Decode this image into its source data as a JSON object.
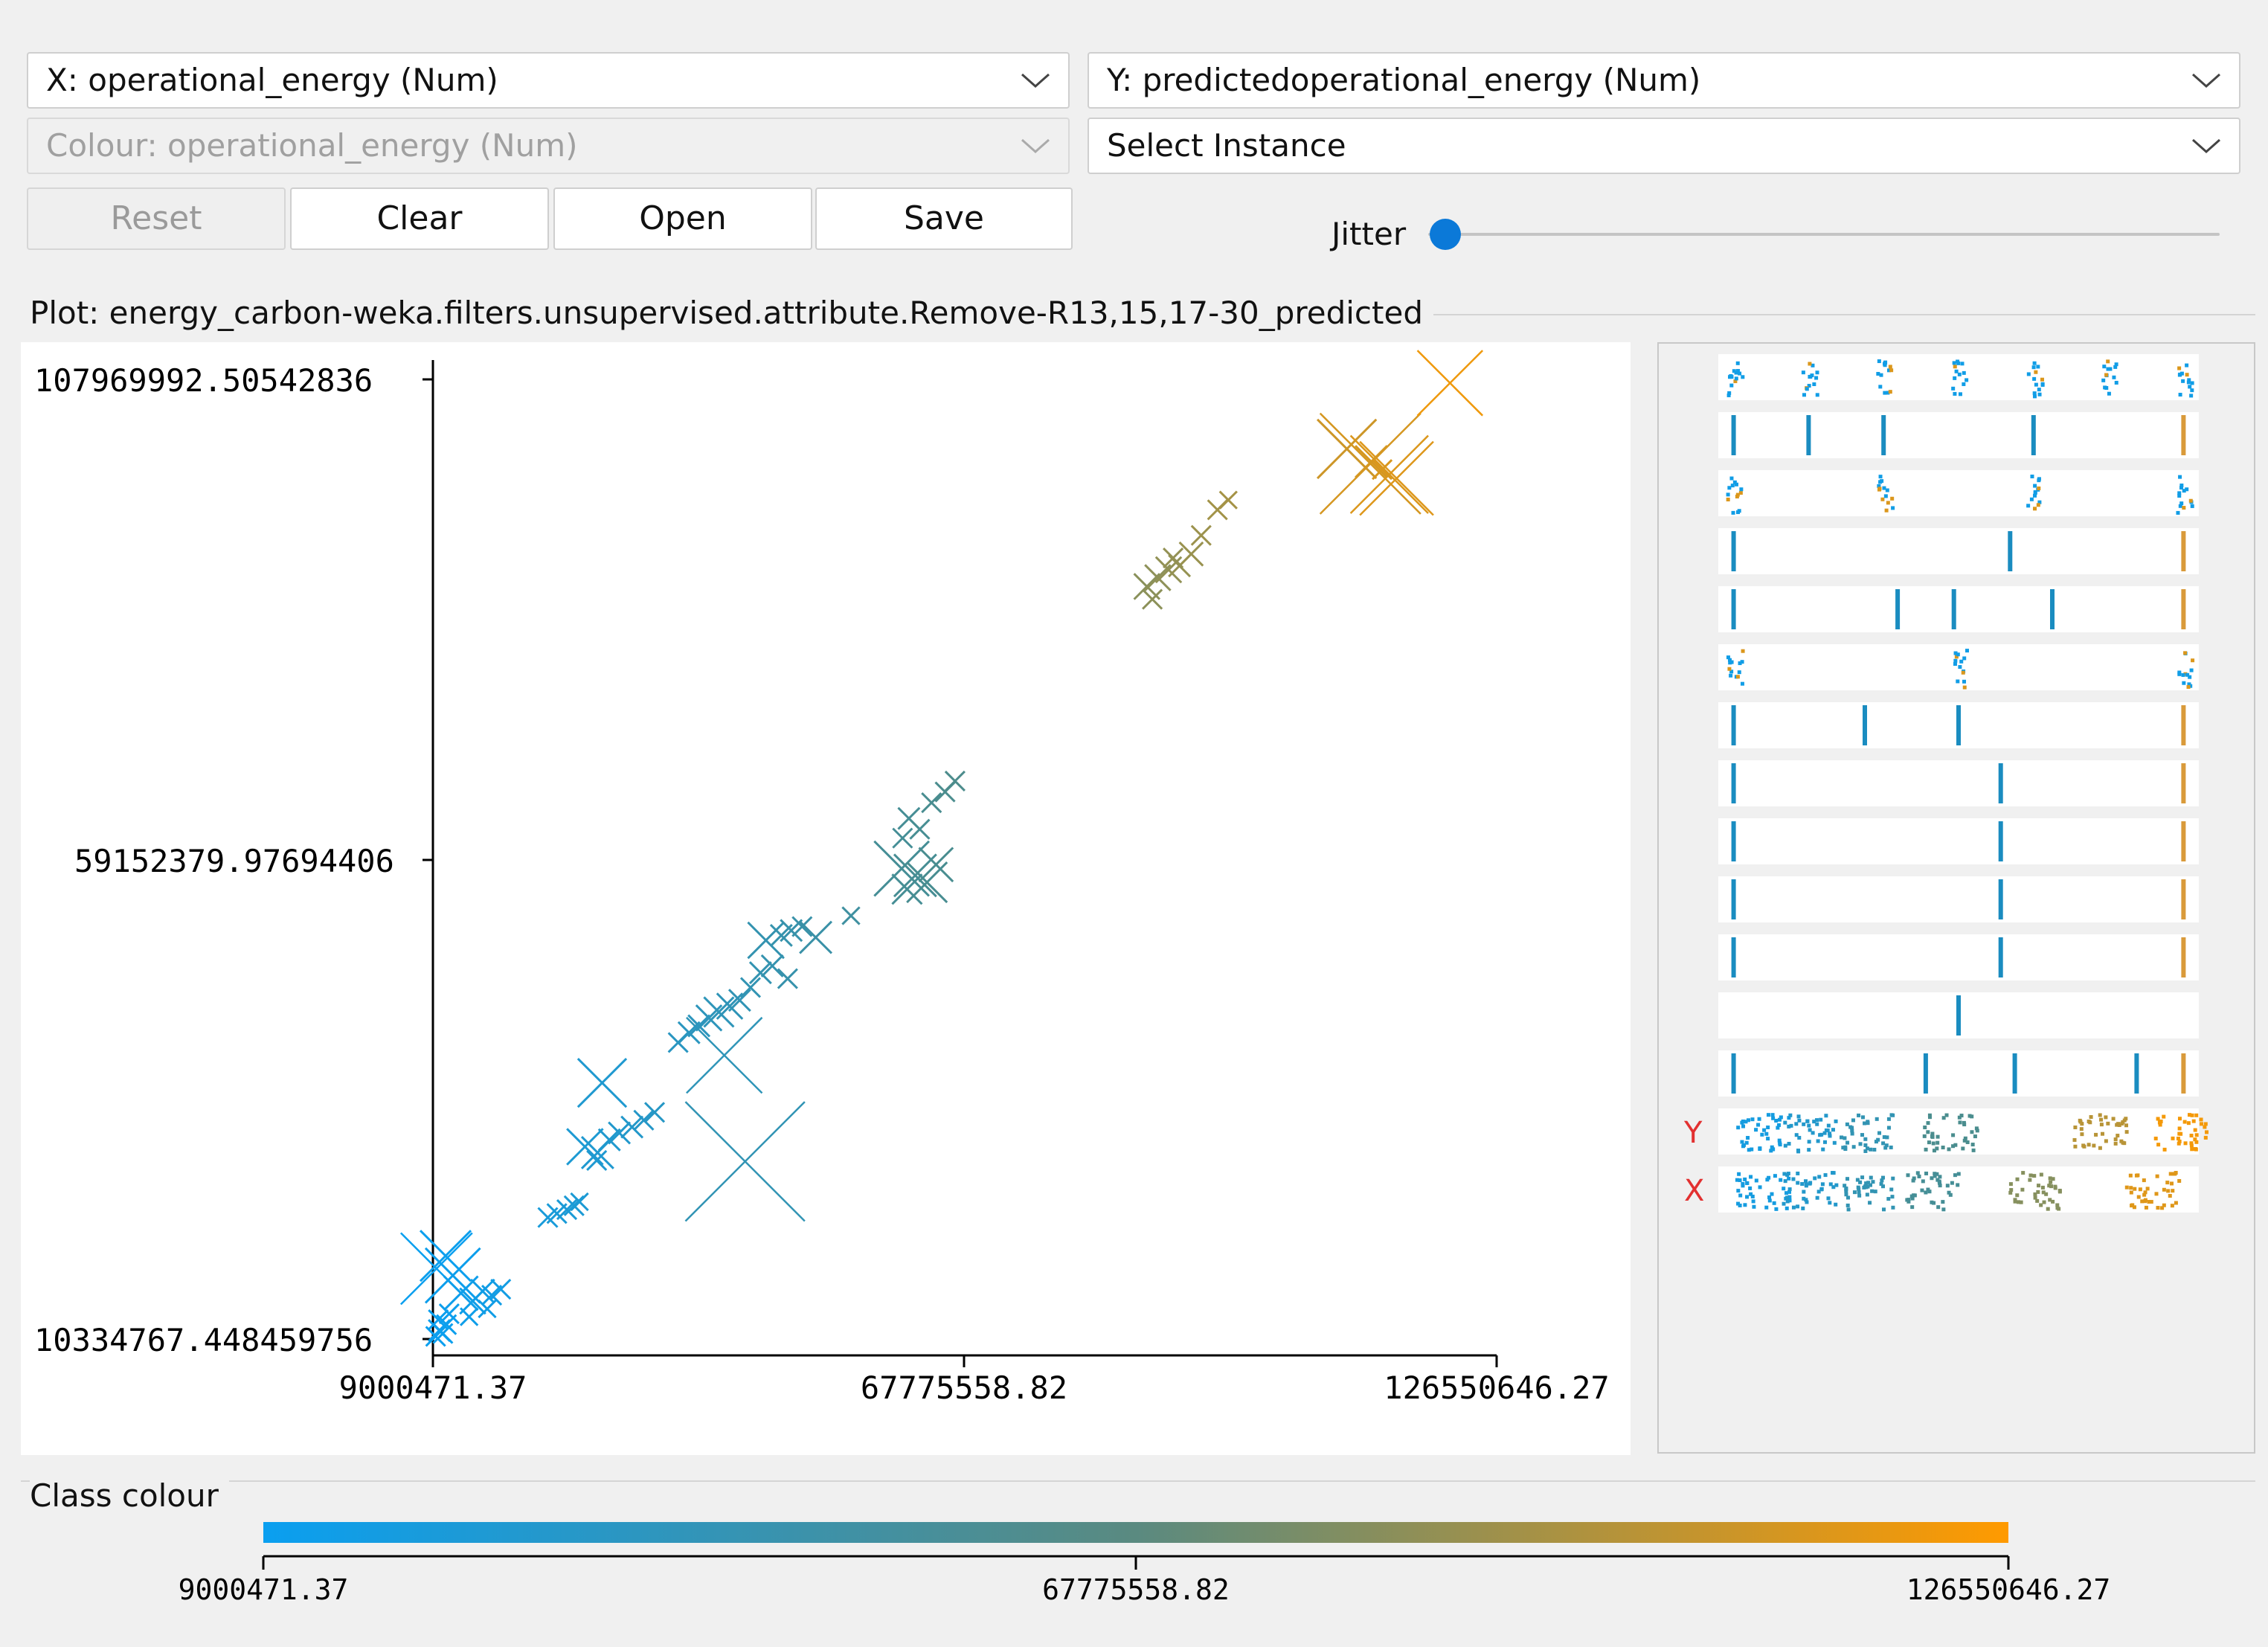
{
  "controls": {
    "x_axis": "X: operational_energy (Num)",
    "y_axis": "Y: predictedoperational_energy (Num)",
    "colour": "Colour: operational_energy (Num)",
    "select_instance": "Select Instance",
    "reset": "Reset",
    "clear": "Clear",
    "open": "Open",
    "save": "Save",
    "jitter_label": "Jitter",
    "jitter_value": 0
  },
  "plot": {
    "title": "Plot: energy_carbon-weka.filters.unsupervised.attribute.Remove-R13,15,17-30_predicted",
    "y_ticks": [
      "107969992.50542836",
      "59152379.97694406",
      "10334767.448459756"
    ],
    "x_ticks": [
      "9000471.37",
      "67775558.82",
      "126550646.27"
    ]
  },
  "chart_data": {
    "type": "scatter",
    "xlabel": "operational_energy",
    "ylabel": "predictedoperational_energy",
    "xlim": [
      9000471.37,
      126550646.27
    ],
    "ylim": [
      10334767.448459756,
      107969992.50542836
    ],
    "color_scale": [
      "#0a9ff0",
      "#4d8c8a",
      "#ff9a00"
    ],
    "points": [
      {
        "x": 9300000,
        "y": 10600000,
        "e": 0.5
      },
      {
        "x": 9700000,
        "y": 11200000,
        "e": 0.6
      },
      {
        "x": 10100000,
        "y": 10900000,
        "e": 0.5
      },
      {
        "x": 10500000,
        "y": 11800000,
        "e": 0.5
      },
      {
        "x": 9600000,
        "y": 12300000,
        "e": 0.5
      },
      {
        "x": 10800000,
        "y": 12900000,
        "e": 0.5
      },
      {
        "x": 9400000,
        "y": 17500000,
        "e": 3.0
      },
      {
        "x": 10400000,
        "y": 18800000,
        "e": 2.0
      },
      {
        "x": 11200000,
        "y": 16800000,
        "e": 2.2
      },
      {
        "x": 12100000,
        "y": 15000000,
        "e": 1.2
      },
      {
        "x": 13400000,
        "y": 14200000,
        "e": 0.8
      },
      {
        "x": 14500000,
        "y": 15200000,
        "e": 0.7
      },
      {
        "x": 15500000,
        "y": 14800000,
        "e": 0.5
      },
      {
        "x": 16500000,
        "y": 15400000,
        "e": 0.5
      },
      {
        "x": 15000000,
        "y": 13400000,
        "e": 0.4
      },
      {
        "x": 13000000,
        "y": 12600000,
        "e": 0.4
      },
      {
        "x": 21700000,
        "y": 22700000,
        "e": 0.5
      },
      {
        "x": 22700000,
        "y": 23100000,
        "e": 0.5
      },
      {
        "x": 23800000,
        "y": 23500000,
        "e": 0.5
      },
      {
        "x": 24600000,
        "y": 23900000,
        "e": 0.5
      },
      {
        "x": 25200000,
        "y": 24300000,
        "e": 0.4
      },
      {
        "x": 25800000,
        "y": 29900000,
        "e": 1.3
      },
      {
        "x": 27200000,
        "y": 29300000,
        "e": 1.1
      },
      {
        "x": 28500000,
        "y": 30600000,
        "e": 0.6
      },
      {
        "x": 29600000,
        "y": 31300000,
        "e": 0.6
      },
      {
        "x": 31000000,
        "y": 31900000,
        "e": 0.6
      },
      {
        "x": 32300000,
        "y": 32600000,
        "e": 0.5
      },
      {
        "x": 33500000,
        "y": 33400000,
        "e": 0.5
      },
      {
        "x": 27100000,
        "y": 28500000,
        "e": 0.5
      },
      {
        "x": 27700000,
        "y": 36400000,
        "e": 1.9
      },
      {
        "x": 41200000,
        "y": 39200000,
        "e": 3.2
      },
      {
        "x": 43500000,
        "y": 28400000,
        "e": 5.3
      },
      {
        "x": 36100000,
        "y": 40500000,
        "e": 0.5
      },
      {
        "x": 37300000,
        "y": 41500000,
        "e": 0.6
      },
      {
        "x": 38400000,
        "y": 42200000,
        "e": 0.6
      },
      {
        "x": 39500000,
        "y": 43000000,
        "e": 0.8
      },
      {
        "x": 40600000,
        "y": 43600000,
        "e": 1.0
      },
      {
        "x": 41800000,
        "y": 44200000,
        "e": 0.8
      },
      {
        "x": 42900000,
        "y": 44800000,
        "e": 0.6
      },
      {
        "x": 44100000,
        "y": 46100000,
        "e": 0.5
      },
      {
        "x": 45200000,
        "y": 47600000,
        "e": 0.6
      },
      {
        "x": 46500000,
        "y": 48300000,
        "e": 0.6
      },
      {
        "x": 45800000,
        "y": 50900000,
        "e": 1.3
      },
      {
        "x": 47500000,
        "y": 51400000,
        "e": 0.6
      },
      {
        "x": 48600000,
        "y": 51900000,
        "e": 0.6
      },
      {
        "x": 49800000,
        "y": 52300000,
        "e": 0.5
      },
      {
        "x": 51300000,
        "y": 51200000,
        "e": 1.1
      },
      {
        "x": 48200000,
        "y": 47000000,
        "e": 0.5
      },
      {
        "x": 55200000,
        "y": 53400000,
        "e": 0.4
      },
      {
        "x": 60800000,
        "y": 58200000,
        "e": 2.2
      },
      {
        "x": 62300000,
        "y": 57500000,
        "e": 1.6
      },
      {
        "x": 63600000,
        "y": 56800000,
        "e": 1.5
      },
      {
        "x": 64600000,
        "y": 58600000,
        "e": 1.2
      },
      {
        "x": 61400000,
        "y": 56100000,
        "e": 1.0
      },
      {
        "x": 60900000,
        "y": 61300000,
        "e": 0.5
      },
      {
        "x": 61600000,
        "y": 63300000,
        "e": 0.6
      },
      {
        "x": 62800000,
        "y": 62200000,
        "e": 0.5
      },
      {
        "x": 64100000,
        "y": 64900000,
        "e": 0.5
      },
      {
        "x": 65600000,
        "y": 66000000,
        "e": 0.5
      },
      {
        "x": 66700000,
        "y": 67100000,
        "e": 0.5
      },
      {
        "x": 87900000,
        "y": 86900000,
        "e": 0.8
      },
      {
        "x": 89100000,
        "y": 87800000,
        "e": 0.8
      },
      {
        "x": 90300000,
        "y": 88600000,
        "e": 0.8
      },
      {
        "x": 91500000,
        "y": 89000000,
        "e": 0.6
      },
      {
        "x": 92800000,
        "y": 90200000,
        "e": 0.7
      },
      {
        "x": 88500000,
        "y": 85600000,
        "e": 0.5
      },
      {
        "x": 90800000,
        "y": 89800000,
        "e": 0.5
      },
      {
        "x": 93900000,
        "y": 92100000,
        "e": 0.5
      },
      {
        "x": 95700000,
        "y": 94700000,
        "e": 0.5
      },
      {
        "x": 96900000,
        "y": 95700000,
        "e": 0.4
      },
      {
        "x": 110000000,
        "y": 100900000,
        "e": 2.4
      },
      {
        "x": 112600000,
        "y": 99400000,
        "e": 4.4
      },
      {
        "x": 114700000,
        "y": 98300000,
        "e": 3.3
      },
      {
        "x": 115500000,
        "y": 97900000,
        "e": 3.1
      },
      {
        "x": 121400000,
        "y": 107600000,
        "e": 2.7
      },
      {
        "x": 112700000,
        "y": 99600000,
        "e": 1.1
      },
      {
        "x": 113900000,
        "y": 98800000,
        "e": 0.5
      }
    ]
  },
  "matrix": {
    "y_label": "Y",
    "x_label": "X",
    "rows": [
      {
        "kind": "scatter",
        "marks": [
          0.02,
          0.18,
          0.34,
          0.5,
          0.66,
          0.82,
          0.98
        ]
      },
      {
        "kind": "lines",
        "marks": [
          0.02,
          0.18,
          0.34,
          0.66,
          0.98
        ]
      },
      {
        "kind": "scatter",
        "marks": [
          0.02,
          0.34,
          0.66,
          0.98
        ]
      },
      {
        "kind": "lines",
        "marks": [
          0.02,
          0.61,
          0.98
        ]
      },
      {
        "kind": "lines",
        "marks": [
          0.02,
          0.37,
          0.49,
          0.7,
          0.98
        ]
      },
      {
        "kind": "scatter",
        "marks": [
          0.02,
          0.5,
          0.98
        ]
      },
      {
        "kind": "lines",
        "marks": [
          0.02,
          0.3,
          0.5,
          0.98
        ]
      },
      {
        "kind": "lines",
        "marks": [
          0.02,
          0.59,
          0.98
        ]
      },
      {
        "kind": "lines",
        "marks": [
          0.02,
          0.59,
          0.98
        ]
      },
      {
        "kind": "lines",
        "marks": [
          0.02,
          0.59,
          0.98
        ]
      },
      {
        "kind": "lines",
        "marks": [
          0.02,
          0.59,
          0.98
        ]
      },
      {
        "kind": "lines",
        "marks": [
          0.5
        ]
      },
      {
        "kind": "lines",
        "marks": [
          0.02,
          0.43,
          0.62,
          0.88,
          0.98
        ]
      },
      {
        "kind": "dense",
        "marks": [
          0.08,
          0.18,
          0.3,
          0.48,
          0.8,
          0.97
        ]
      },
      {
        "kind": "dense",
        "marks": [
          0.08,
          0.18,
          0.3,
          0.44,
          0.66,
          0.91
        ]
      }
    ]
  },
  "class_colour": {
    "label": "Class colour",
    "ticks": [
      "9000471.37",
      "67775558.82",
      "126550646.27"
    ]
  }
}
